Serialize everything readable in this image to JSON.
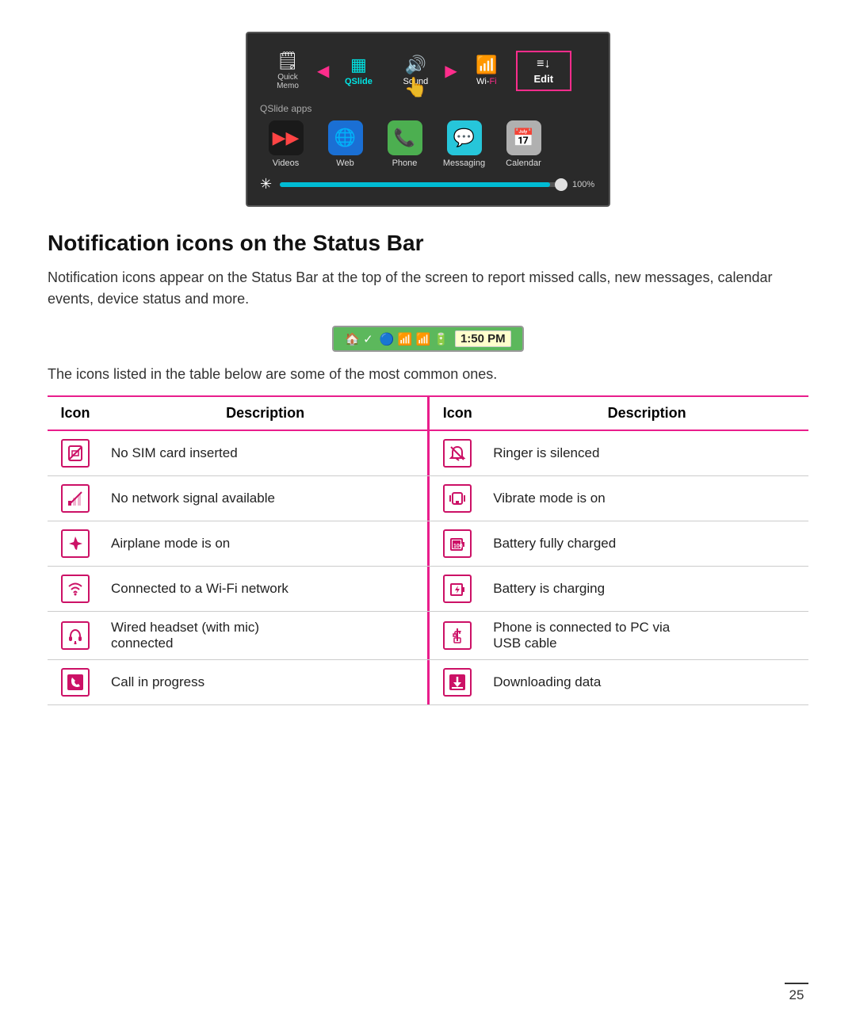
{
  "screenshot": {
    "controls": [
      {
        "id": "quick-memo",
        "icon": "🗒",
        "label": "Quick\nMemo"
      },
      {
        "id": "qslide",
        "icon": "▦",
        "label": "QSlide",
        "colored": true
      },
      {
        "id": "sound",
        "icon": "🔊",
        "label": "Sound"
      },
      {
        "id": "wifi",
        "icon": "📶",
        "label": "Wi-Fi"
      },
      {
        "id": "edit",
        "icon": "≡↓",
        "label": "Edit",
        "highlight": true
      }
    ],
    "qslide_apps_label": "QSlide apps",
    "apps": [
      {
        "id": "videos",
        "icon": "▶",
        "label": "Videos"
      },
      {
        "id": "web",
        "icon": "🌐",
        "label": "Web"
      },
      {
        "id": "phone",
        "icon": "📞",
        "label": "Phone"
      },
      {
        "id": "messaging",
        "icon": "💬",
        "label": "Messaging"
      },
      {
        "id": "calendar",
        "icon": "📅",
        "label": "Calendar"
      }
    ],
    "brightness_pct": "100%"
  },
  "heading": "Notification icons on the Status Bar",
  "description": "Notification icons appear on the Status Bar at the top of the screen to report missed calls, new messages, calendar events, device status and more.",
  "statusbar": {
    "left_icons": "🏠✓",
    "bluetooth": "🔵",
    "wifi": "📶",
    "signal": "📶",
    "battery": "🔋",
    "time": "1:50 PM"
  },
  "common_icons_label": "The icons listed in the table below are some of the most common ones.",
  "table_header": {
    "col1": "Icon",
    "col2": "Description",
    "col3": "Icon",
    "col4": "Description"
  },
  "table_rows": [
    {
      "left_desc": "No SIM card inserted",
      "right_desc": "Ringer is silenced"
    },
    {
      "left_desc": "No network signal available",
      "right_desc": "Vibrate mode is on"
    },
    {
      "left_desc": "Airplane mode is on",
      "right_desc": "Battery fully charged"
    },
    {
      "left_desc": "Connected to a Wi-Fi network",
      "right_desc": "Battery is charging"
    },
    {
      "left_desc": "Wired headset (with mic)\nconnected",
      "right_desc": "Phone is connected to PC via\nUSB cable"
    },
    {
      "left_desc": "Call in progress",
      "right_desc": "Downloading data"
    }
  ],
  "page_number": "25"
}
